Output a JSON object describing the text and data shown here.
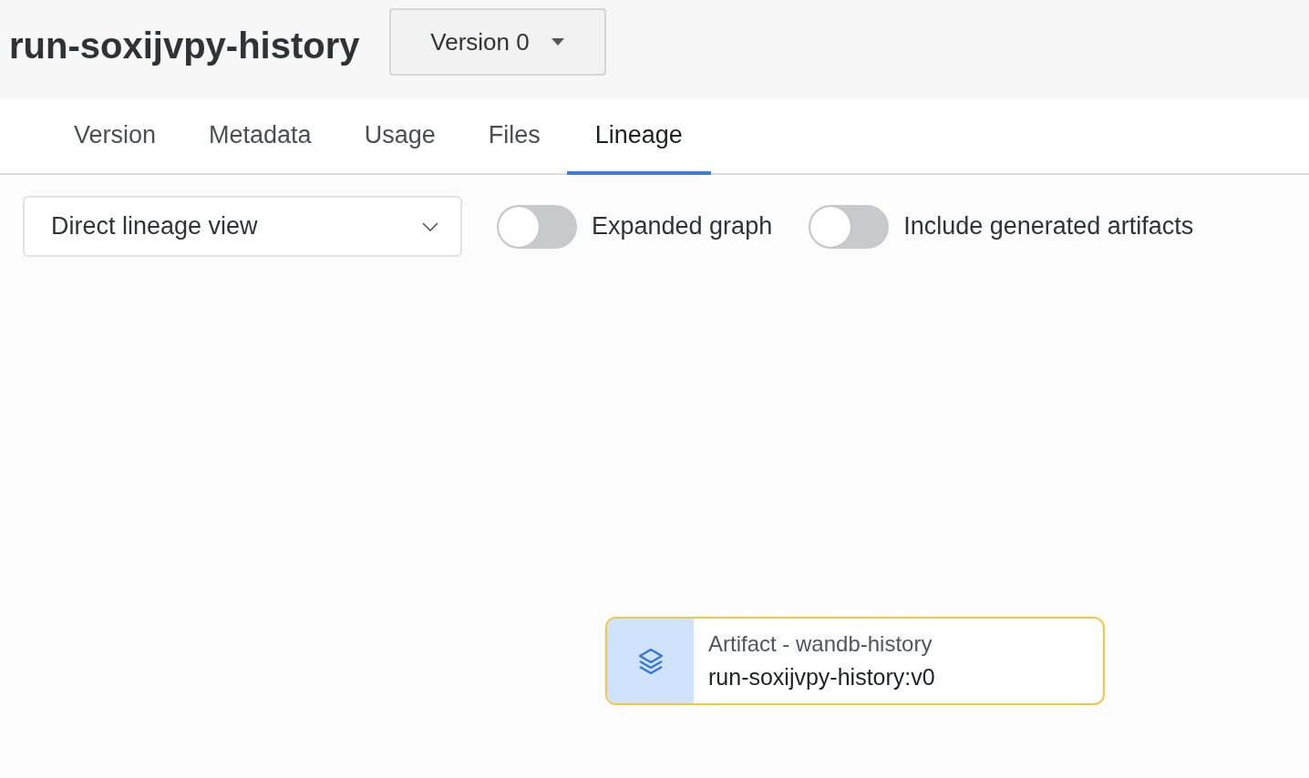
{
  "header": {
    "title": "run-soxijvpy-history",
    "version_select": {
      "value": "Version 0"
    }
  },
  "tabs": [
    {
      "label": "Version",
      "selected": false
    },
    {
      "label": "Metadata",
      "selected": false
    },
    {
      "label": "Usage",
      "selected": false
    },
    {
      "label": "Files",
      "selected": false
    },
    {
      "label": "Lineage",
      "selected": true
    }
  ],
  "controls": {
    "view_select": {
      "value": "Direct lineage view"
    },
    "toggles": [
      {
        "label": "Expanded graph",
        "on": false
      },
      {
        "label": "Include generated artifacts",
        "on": false
      }
    ]
  },
  "graph": {
    "nodes": [
      {
        "kind": "artifact",
        "type_label": "Artifact - wandb-history",
        "name": "run-soxijvpy-history:v0",
        "selected": true
      }
    ]
  }
}
